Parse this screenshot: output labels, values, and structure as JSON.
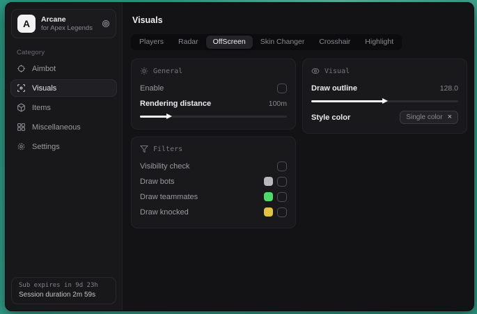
{
  "app": {
    "logo_letter": "A",
    "title": "Arcane",
    "subtitle": "for Apex Legends"
  },
  "sidebar": {
    "category_label": "Category",
    "items": [
      {
        "label": "Aimbot",
        "icon": "crosshair-icon",
        "active": false
      },
      {
        "label": "Visuals",
        "icon": "scan-eye-icon",
        "active": true
      },
      {
        "label": "Items",
        "icon": "package-icon",
        "active": false
      },
      {
        "label": "Miscellaneous",
        "icon": "grid-icon",
        "active": false
      },
      {
        "label": "Settings",
        "icon": "gear-icon",
        "active": false
      }
    ],
    "footer": {
      "sub_expires": "Sub expires in 9d 23h",
      "session_duration": "Session duration 2m 59s"
    }
  },
  "main": {
    "title": "Visuals",
    "tabs": [
      {
        "label": "Players",
        "active": false
      },
      {
        "label": "Radar",
        "active": false
      },
      {
        "label": "OffScreen",
        "active": true
      },
      {
        "label": "Skin Changer",
        "active": false
      },
      {
        "label": "Crosshair",
        "active": false
      },
      {
        "label": "Highlight",
        "active": false
      }
    ],
    "general": {
      "title": "General",
      "enable_label": "Enable",
      "enable_checked": false,
      "distance_label": "Rendering distance",
      "distance_value": "100m",
      "distance_percent": 20
    },
    "visual": {
      "title": "Visual",
      "outline_label": "Draw outline",
      "outline_value": "128.0",
      "outline_percent": 50,
      "style_label": "Style color",
      "style_tag": "Single color",
      "style_remove": "×"
    },
    "filters": {
      "title": "Filters",
      "rows": [
        {
          "label": "Visibility check",
          "swatch": null,
          "checked": false
        },
        {
          "label": "Draw bots",
          "swatch": "#b9b9bd",
          "checked": false
        },
        {
          "label": "Draw teammates",
          "swatch": "#4fd96a",
          "checked": false
        },
        {
          "label": "Draw knocked",
          "swatch": "#e2c344",
          "checked": false
        }
      ]
    }
  },
  "colors": {
    "desktop_background": "#2f9d87",
    "window_background": "#151517",
    "card_background": "#19191c",
    "accent_text": "#ececef"
  }
}
